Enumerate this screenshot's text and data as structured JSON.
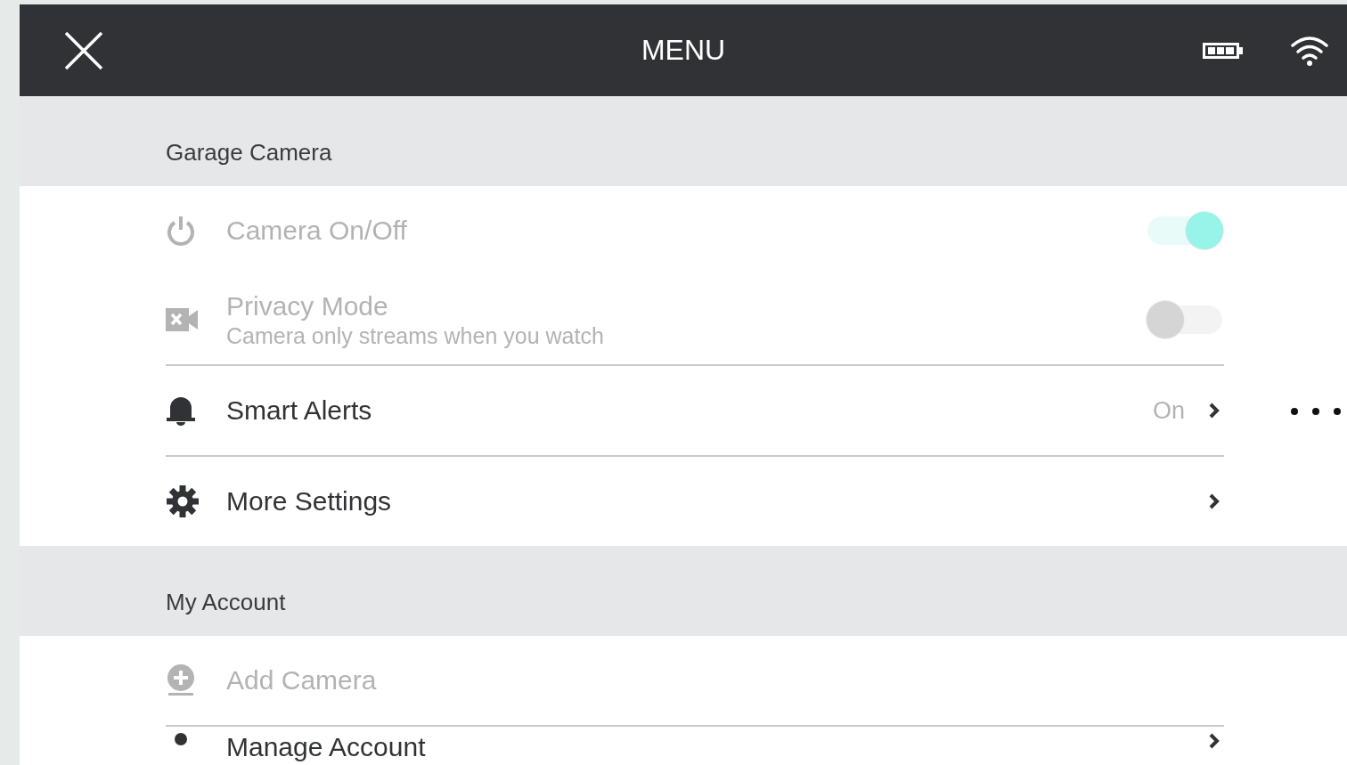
{
  "header": {
    "title": "MENU"
  },
  "sections": [
    {
      "title": "Garage Camera",
      "items": [
        {
          "kind": "toggle",
          "label": "Camera On/Off",
          "on": true,
          "disabled": true
        },
        {
          "kind": "toggle",
          "label": "Privacy Mode",
          "subtitle": "Camera only streams when you watch",
          "on": false,
          "disabled": true
        },
        {
          "kind": "link",
          "label": "Smart Alerts",
          "value": "On",
          "disabled": false
        },
        {
          "kind": "link",
          "label": "More Settings",
          "disabled": false
        }
      ]
    },
    {
      "title": "My Account",
      "items": [
        {
          "kind": "action",
          "label": "Add Camera",
          "disabled": true
        },
        {
          "kind": "link",
          "label": "Manage Account",
          "disabled": false
        }
      ]
    }
  ]
}
